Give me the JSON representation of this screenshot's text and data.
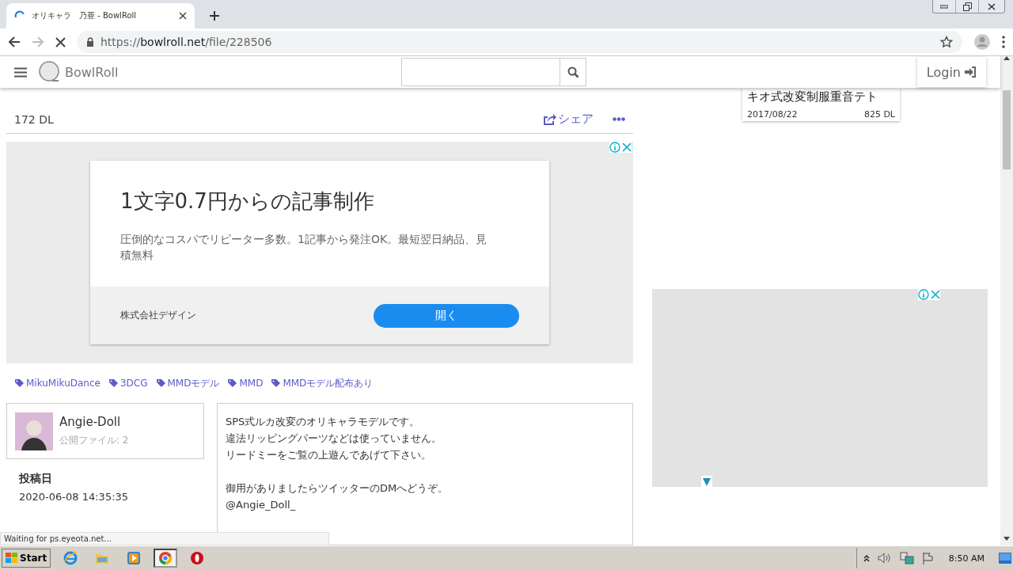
{
  "browser": {
    "tab": {
      "title": "オリキャラ　乃亜 - BowlRoll",
      "loading": true
    },
    "url": {
      "scheme": "https://",
      "host": "bowlroll.net",
      "path": "/file/228506"
    },
    "forward_disabled": true
  },
  "site_header": {
    "logo": "BowlRoll",
    "login": "Login"
  },
  "file": {
    "downloads": "172 DL",
    "share": "シェア"
  },
  "ad": {
    "headline": "1文字0.7円からの記事制作",
    "body": "圧倒的なコスパでリピーター多数。1記事から発注OK。最短翌日納品、見積無料",
    "advertiser": "株式会社デザイン",
    "button": "開く"
  },
  "tags": [
    "MikuMikuDance",
    "3DCG",
    "MMDモデル",
    "MMD",
    "MMDモデル配布あり"
  ],
  "author": {
    "name": "Angie-Doll",
    "files": "公開ファイル: 2"
  },
  "posted": {
    "label": "投稿日",
    "date": "2020-06-08 14:35:35"
  },
  "description": [
    [
      "SPS式ルカ改変のオリキャラモデルです。",
      "違法リッピングパーツなどは使っていません。",
      "リードミーをご覧の上遊んであげて下さい。"
    ],
    [
      "御用がありましたらツイッターのDMへどうぞ。",
      "@Angie_Doll_"
    ]
  ],
  "sidebar_card": {
    "title": "キオ式改変制服重音テト",
    "date": "2017/08/22",
    "downloads": "825 DL"
  },
  "status": "Waiting for ps.eyeota.net...",
  "taskbar": {
    "start": "Start",
    "apps": [
      {
        "kind": "ie",
        "selected": false
      },
      {
        "kind": "folder",
        "selected": false
      },
      {
        "kind": "media",
        "selected": false
      },
      {
        "kind": "chrome",
        "selected": true
      },
      {
        "kind": "opera",
        "selected": false
      }
    ],
    "time": "8:50 AM"
  }
}
